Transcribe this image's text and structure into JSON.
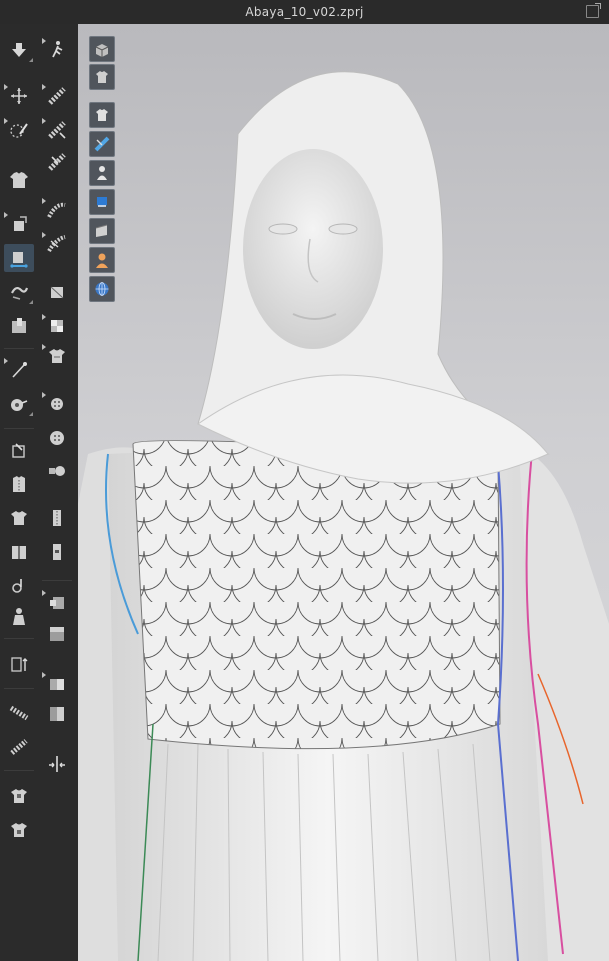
{
  "window": {
    "title": "Abaya_10_v02.zprj"
  },
  "toolbar": {
    "tools": [
      {
        "name": "simulation-icon"
      },
      {
        "name": "walk-animation-icon"
      },
      {
        "name": "transform-pattern-icon"
      },
      {
        "name": "select-mesh-icon"
      },
      {
        "name": "edit-pattern-icon"
      },
      {
        "name": "fold-arrangement-icon"
      },
      {
        "name": "garment-select-icon"
      },
      {
        "name": "steam-icon"
      },
      {
        "name": "tack-icon"
      },
      {
        "name": "shorten-icon"
      },
      {
        "name": "pin-icon"
      },
      {
        "name": "puckering-icon"
      },
      {
        "name": "arrangement-point-icon"
      },
      {
        "name": "gather-icon"
      },
      {
        "name": "fold-icon"
      },
      {
        "name": "texture-edit-icon"
      },
      {
        "name": "brush-icon"
      },
      {
        "name": "button-icon"
      },
      {
        "name": "tape-icon"
      },
      {
        "name": "buttonhole-icon"
      },
      {
        "name": "sew-icon"
      },
      {
        "name": "lock-button-icon"
      },
      {
        "name": "zipper-icon"
      },
      {
        "name": "topstitch-icon"
      },
      {
        "name": "trim-icon"
      },
      {
        "name": "zipper-puller-icon"
      },
      {
        "name": "elastic-icon"
      },
      {
        "name": "box-select-icon"
      },
      {
        "name": "avatar-tool-icon"
      },
      {
        "name": "box-edit-icon"
      },
      {
        "name": "measure-icon"
      },
      {
        "name": "graphic-icon"
      },
      {
        "name": "ruler-icon"
      },
      {
        "name": "graphic-edit-icon"
      },
      {
        "name": "strength-map-icon"
      },
      {
        "name": "fit-map-icon"
      },
      {
        "name": "mannequin-icon"
      },
      {
        "name": "mannequin-edit-icon"
      }
    ]
  },
  "viewport_tools": [
    {
      "name": "view-3d-box-icon"
    },
    {
      "name": "view-garment-icon"
    },
    {
      "name": "show-garment-icon"
    },
    {
      "name": "show-pattern-icon"
    },
    {
      "name": "show-avatar-icon"
    },
    {
      "name": "show-fabric-icon"
    },
    {
      "name": "show-surface-icon"
    },
    {
      "name": "show-skin-icon"
    },
    {
      "name": "show-environment-icon"
    }
  ]
}
